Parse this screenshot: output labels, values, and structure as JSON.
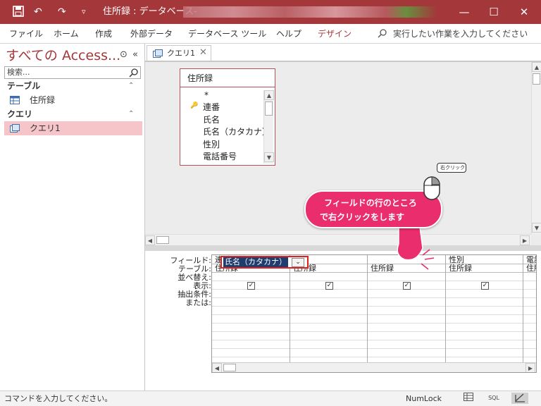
{
  "window": {
    "title": "住所録 : データベース-",
    "controls": {
      "minimize": "—",
      "maximize": "☐",
      "close": "✕"
    }
  },
  "quick_access": {
    "save": "save-icon",
    "undo": "↶",
    "redo": "↷",
    "customize": "▿"
  },
  "ribbon": {
    "tabs": [
      "ファイル",
      "ホーム",
      "作成",
      "外部データ",
      "データベース ツール",
      "ヘルプ",
      "デザイン"
    ],
    "active_tab": "デザイン",
    "tell_me": "実行したい作業を入力してください"
  },
  "nav": {
    "title": "すべての Access...",
    "search_placeholder": "検索...",
    "groups": [
      {
        "label": "テーブル",
        "items": [
          {
            "label": "住所録",
            "icon": "table-icon"
          }
        ]
      },
      {
        "label": "クエリ",
        "items": [
          {
            "label": "クエリ1",
            "icon": "query-icon",
            "selected": true
          }
        ]
      }
    ]
  },
  "doc_tab": {
    "label": "クエリ1",
    "close": "✕"
  },
  "table_box": {
    "name": "住所録",
    "fields": [
      "*",
      "連番",
      "氏名",
      "氏名（カタカナ）",
      "性別",
      "電話番号"
    ],
    "primary_key": "連番"
  },
  "design_grid": {
    "row_labels": [
      "フィールド:",
      "テーブル:",
      "並べ替え:",
      "表示:",
      "抽出条件:",
      "または:"
    ],
    "columns": [
      {
        "field": "連番",
        "table": "住所録",
        "show": true
      },
      {
        "field": "氏名",
        "table": "住所録",
        "show": true
      },
      {
        "field": "氏名（カタカナ）",
        "table": "住所録",
        "show": true,
        "selected": true
      },
      {
        "field": "性別",
        "table": "住所録",
        "show": true
      },
      {
        "field": "電話",
        "table": "住所",
        "show": false
      }
    ]
  },
  "annotation": {
    "callout_line1": "フィールドの行のところ",
    "callout_line2": "で右クリックをします",
    "mouse_label": "右クリック",
    "accent": "#ea2d6d"
  },
  "status": {
    "message": "コマンドを入力してください。",
    "numlock": "NumLock",
    "views": [
      "datasheet-view-icon",
      "SQL",
      "design-view-icon"
    ]
  },
  "colors": {
    "titlebar": "#a4373a",
    "nav_selected": "#f6c5c9",
    "highlight_box": "#e0201f"
  }
}
